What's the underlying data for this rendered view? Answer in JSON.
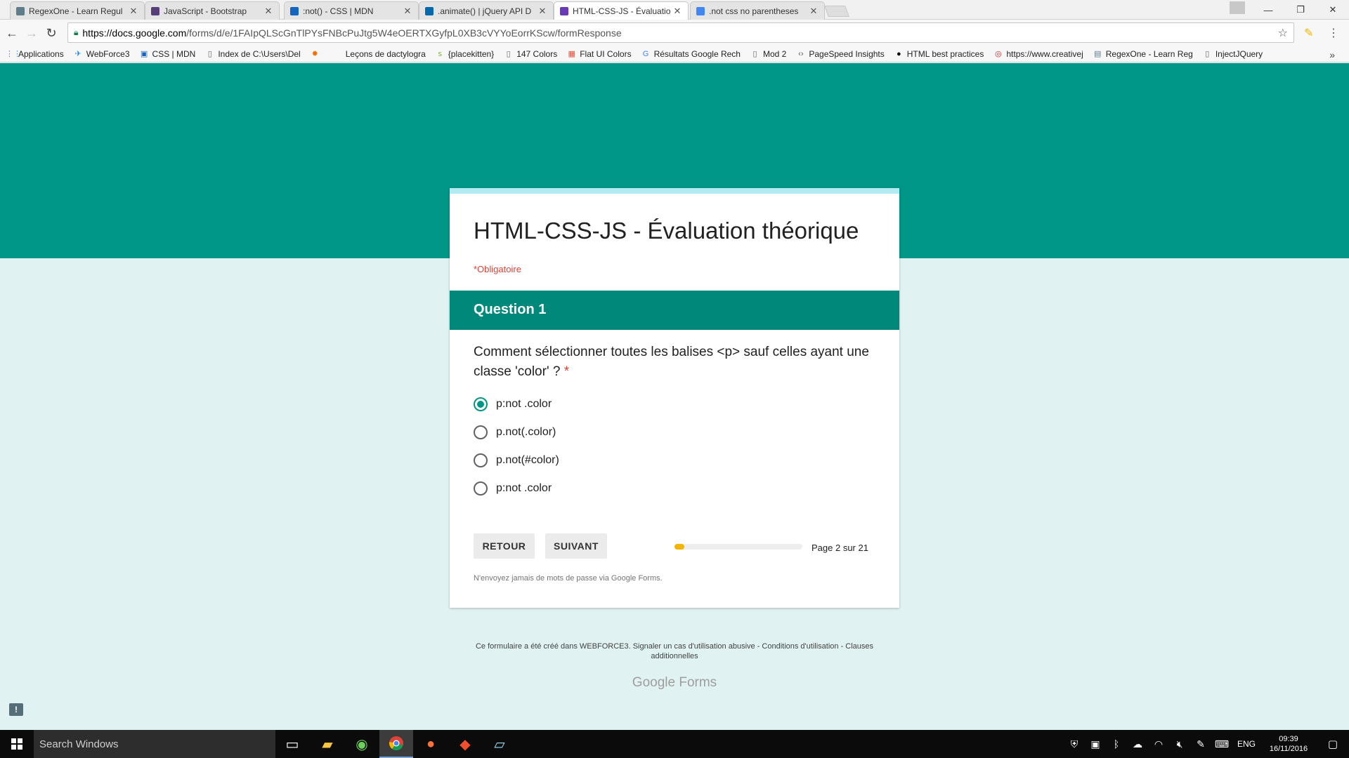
{
  "browser": {
    "tabs": [
      {
        "title": "RegexOne - Learn Regul",
        "icon": "regexone-icon",
        "color": "#607d8b"
      },
      {
        "title": "JavaScript - Bootstrap",
        "icon": "bootstrap-icon",
        "color": "#563d7c"
      },
      {
        "title": ":not() - CSS | MDN",
        "icon": "mdn-icon",
        "color": "#1565c0"
      },
      {
        "title": ".animate() | jQuery API D",
        "icon": "jquery-icon",
        "color": "#0769ad"
      },
      {
        "title": "HTML-CSS-JS - Évaluatio",
        "icon": "google-forms-icon",
        "color": "#673ab7"
      },
      {
        "title": ".not css no parentheses",
        "icon": "google-icon",
        "color": "#4285f4"
      }
    ],
    "url_host": "https://docs.google.com",
    "url_path": "/forms/d/e/1FAIpQLScGnTlPYsFNBcPuJtg5W4eOERTXGyfpL0XB3cVYYoEorrKScw/formResponse",
    "bookmarks": [
      {
        "label": "Applications",
        "icon": "apps-icon",
        "glyph": "⋮⋮",
        "color": "#4285f4"
      },
      {
        "label": "WebForce3",
        "icon": "webforce3-icon",
        "glyph": "✈",
        "color": "#1e88e5"
      },
      {
        "label": "CSS | MDN",
        "icon": "mdn-icon",
        "glyph": "▣",
        "color": "#1565c0"
      },
      {
        "label": "Index de C:\\Users\\Del",
        "icon": "file-icon",
        "glyph": "▯",
        "color": "#666666"
      },
      {
        "label": "",
        "icon": "bug-icon",
        "glyph": "✹",
        "color": "#ef6c00"
      },
      {
        "label": "Leçons de dactylogra",
        "icon": "blank-icon",
        "glyph": "",
        "color": "#666666"
      },
      {
        "label": "{placekitten}",
        "icon": "placekitten-icon",
        "glyph": "ꜱ",
        "color": "#7cb342"
      },
      {
        "label": "147 Colors",
        "icon": "file-icon",
        "glyph": "▯",
        "color": "#666666"
      },
      {
        "label": "Flat UI Colors",
        "icon": "flatui-icon",
        "glyph": "▦",
        "color": "#e74c3c"
      },
      {
        "label": "Résultats Google Rech",
        "icon": "google-icon",
        "glyph": "G",
        "color": "#4285f4"
      },
      {
        "label": "Mod 2",
        "icon": "file-icon",
        "glyph": "▯",
        "color": "#666666"
      },
      {
        "label": "PageSpeed Insights",
        "icon": "code-icon",
        "glyph": "‹›",
        "color": "#555555"
      },
      {
        "label": "HTML best practices",
        "icon": "github-icon",
        "glyph": "●",
        "color": "#111111"
      },
      {
        "label": "https://www.creativej",
        "icon": "creative-icon",
        "glyph": "◎",
        "color": "#c62828"
      },
      {
        "label": "RegexOne - Learn Reg",
        "icon": "regexone-icon",
        "glyph": "▤",
        "color": "#607d8b"
      },
      {
        "label": "InjectJQuery",
        "icon": "file-icon",
        "glyph": "▯",
        "color": "#666666"
      }
    ]
  },
  "form": {
    "title": "HTML-CSS-JS - Évaluation théorique",
    "required_note": "*Obligatoire",
    "section_title": "Question 1",
    "question": "Comment sélectionner toutes les balises <p> sauf celles ayant une classe 'color' ?",
    "required_marker": "*",
    "options": [
      {
        "label": "p:not .color",
        "checked": true
      },
      {
        "label": "p.not(.color)",
        "checked": false
      },
      {
        "label": "p.not(#color)",
        "checked": false
      },
      {
        "label": "p:not .color",
        "checked": false
      }
    ],
    "back_label": "RETOUR",
    "next_label": "SUIVANT",
    "progress": {
      "current": 2,
      "total": 21,
      "text": "Page 2 sur 21"
    },
    "disclaimer": "N'envoyez jamais de mots de passe via Google Forms."
  },
  "footer": {
    "text": "Ce formulaire a été créé dans WEBFORCE3. Signaler un cas d'utilisation abusive - Conditions d'utilisation - Clauses additionnelles",
    "brand_google": "Google",
    "brand_forms": "Forms"
  },
  "taskbar": {
    "search_placeholder": "Search Windows",
    "language": "ENG",
    "time": "09:39",
    "date": "16/11/2016"
  },
  "colors": {
    "header": "#009688",
    "section": "#00897b",
    "accent": "#009688",
    "required": "#db4437",
    "progress": "#f4b400",
    "background": "#e0f2f1"
  }
}
